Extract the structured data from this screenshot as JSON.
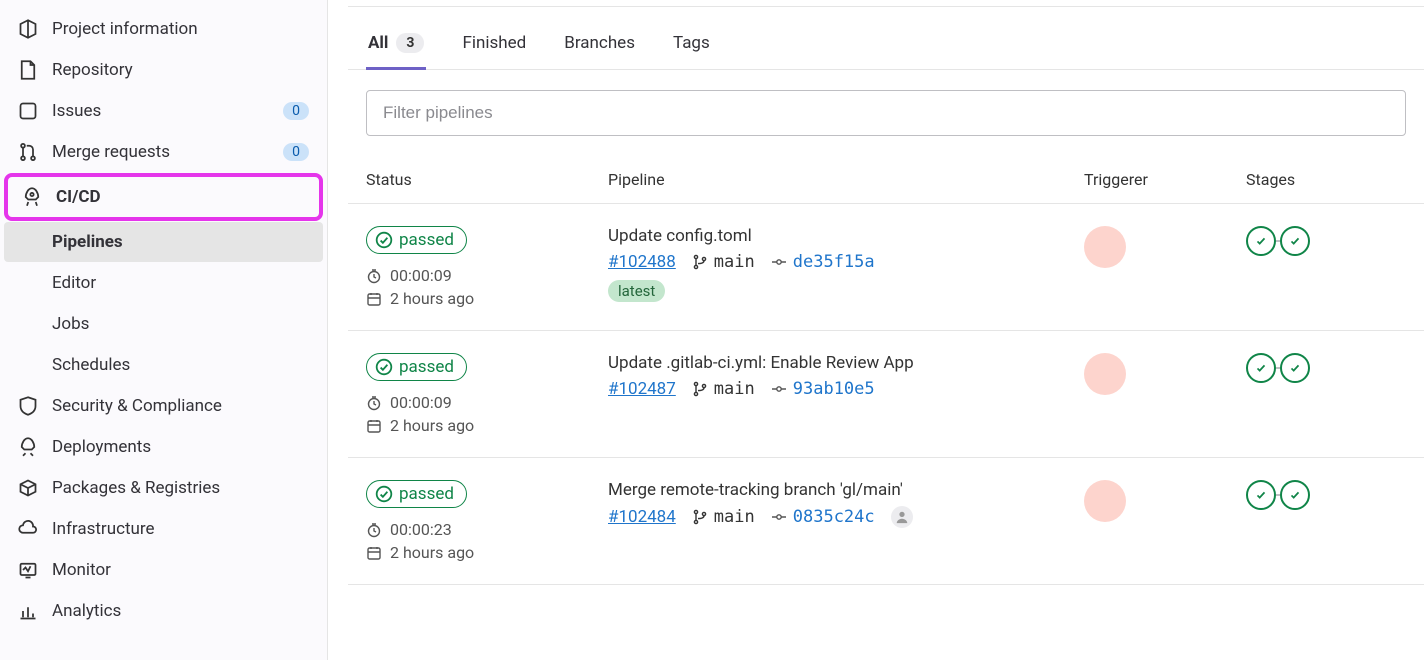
{
  "sidebar": {
    "items": [
      {
        "label": "Project information"
      },
      {
        "label": "Repository"
      },
      {
        "label": "Issues",
        "count": "0"
      },
      {
        "label": "Merge requests",
        "count": "0"
      },
      {
        "label": "CI/CD"
      },
      {
        "label": "Security & Compliance"
      },
      {
        "label": "Deployments"
      },
      {
        "label": "Packages & Registries"
      },
      {
        "label": "Infrastructure"
      },
      {
        "label": "Monitor"
      },
      {
        "label": "Analytics"
      }
    ],
    "cicd_sub": [
      {
        "label": "Pipelines"
      },
      {
        "label": "Editor"
      },
      {
        "label": "Jobs"
      },
      {
        "label": "Schedules"
      }
    ]
  },
  "tabs": {
    "all": {
      "label": "All",
      "count": "3"
    },
    "finished": {
      "label": "Finished"
    },
    "branches": {
      "label": "Branches"
    },
    "tags": {
      "label": "Tags"
    }
  },
  "filter": {
    "placeholder": "Filter pipelines"
  },
  "columns": {
    "status": "Status",
    "pipeline": "Pipeline",
    "triggerer": "Triggerer",
    "stages": "Stages"
  },
  "status_label": "passed",
  "latest_label": "latest",
  "branch_default": "main",
  "pipelines": [
    {
      "title": "Update config.toml",
      "id": "#102488",
      "branch": "main",
      "sha": "de35f15a",
      "duration": "00:00:09",
      "ago": "2 hours ago",
      "latest": true,
      "triggerer_avatar": false
    },
    {
      "title": "Update .gitlab-ci.yml: Enable Review App",
      "id": "#102487",
      "branch": "main",
      "sha": "93ab10e5",
      "duration": "00:00:09",
      "ago": "2 hours ago",
      "latest": false,
      "triggerer_avatar": false
    },
    {
      "title": "Merge remote-tracking branch 'gl/main'",
      "id": "#102484",
      "branch": "main",
      "sha": "0835c24c",
      "duration": "00:00:23",
      "ago": "2 hours ago",
      "latest": false,
      "triggerer_avatar": true
    }
  ]
}
